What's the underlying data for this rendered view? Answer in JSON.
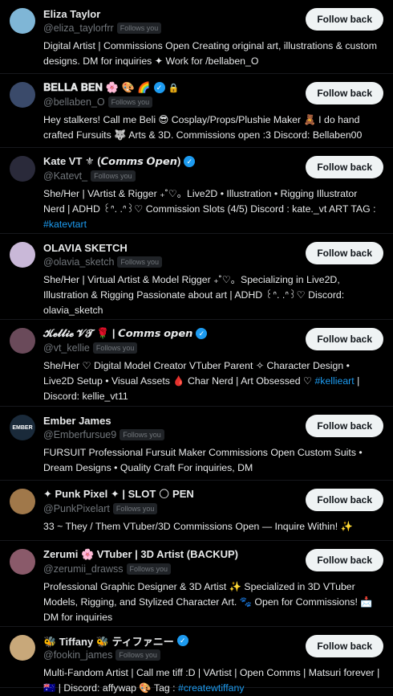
{
  "follow_back_label": "Follow back",
  "follows_you_label": "Follows you",
  "accent": "#1d9bf0",
  "users": [
    {
      "name": "Eliza Taylor",
      "handle": "@eliza_taylorfrr",
      "verified": false,
      "bio": "Digital Artist | Commissions Open Creating original art, illustrations & custom designs. DM for inquiries ✦ Work for /bellaben_O",
      "avatar_color": "#7fb6d6"
    },
    {
      "name": "𝐁𝐄𝐋𝐋𝐀 𝐁𝐄𝐍 🌸 🎨 🌈",
      "handle": "@bellaben_O",
      "verified": true,
      "locked": true,
      "bio": "Hey stalkers! Call me Beli 😎 Cosplay/Props/Plushie Maker 🧸 I do hand crafted Fursuits 🐺 Arts & 3D. Commissions open :3 Discord: Bellaben00",
      "avatar_color": "#3a4a6a"
    },
    {
      "name": "Kate VT ⚜ (𝘾𝙤𝙢𝙢𝙨 𝙊𝙥𝙚𝙣)",
      "handle": "@Katevt_",
      "verified": true,
      "bio": "She/Her | VArtist & Rigger ₊˚♡。Live2D • Illustration • Rigging Illustrator Nerd | ADHD ꒰ᐢ. .ᐢ꒱♡ Commission Slots (4/5) Discord : kate._vt ART TAG :",
      "tag": "#katevtart",
      "avatar_color": "#2a2a3a"
    },
    {
      "name": "OLAVIA SKETCH",
      "handle": "@olavia_sketch",
      "verified": false,
      "bio": "She/Her | Virtual Artist & Model Rigger ₊˚♡。Specializing in Live2D, Illustration & Rigging Passionate about art | ADHD ꒰ᐢ. .ᐢ꒱♡ Discord: olavia_sketch",
      "avatar_color": "#c9b8d8"
    },
    {
      "name": "𝓚𝓮𝓵𝓵𝓲𝓮 𝓥𝓣 🌹 | 𝘾𝙤𝙢𝙢𝙨 𝙤𝙥𝙚𝙣",
      "handle": "@vt_kellie",
      "verified": true,
      "bio": "She/Her ♡ Digital Model Creator VTuber Parent ✧ Character Design • Live2D Setup • Visual Assets 🩸 Char Nerd | Art Obsessed ♡",
      "tag": "#kellieart",
      "bio_after_tag": "| Discord: kellie_vt11",
      "avatar_color": "#6a4a5a"
    },
    {
      "name": "Ember James",
      "handle": "@Emberfursue9",
      "verified": false,
      "bio": "FURSUIT Professional Fursuit Maker Commissions Open Custom Suits • Dream Designs • Quality Craft For inquiries, DM",
      "avatar_color": "#1a2a3a",
      "avatar_text": "EMBER"
    },
    {
      "name": "✦ Punk Pixel ✦ | SLOT 🌕 PEN",
      "handle": "@PunkPixelart",
      "verified": false,
      "bio": "33 ~ They / Them VTuber/3D Commissions Open — Inquire Within! ✨",
      "avatar_color": "#a0784a"
    },
    {
      "name": "Zerumi 🌸 VTuber | 3D Artist (BACKUP)",
      "handle": "@zerumii_drawss",
      "verified": false,
      "bio": "Professional Graphic Designer & 3D Artist ✨ Specialized in 3D VTuber Models, Rigging, and Stylized Character Art. 🐾 Open for Commissions! 📩 DM for inquiries",
      "avatar_color": "#8a5a6a"
    },
    {
      "name": "🐝 Tiffany 🐝 ティファニー",
      "handle": "@fookin_james",
      "verified": true,
      "bio": "Multi-Fandom Artist | Call me tiff :D | VArtist | Open Comms | Matsuri forever | 🇦🇺 | Discord: affywap 🎨 Tag :",
      "tag": "#createwtiffany",
      "avatar_color": "#c8a87a"
    }
  ]
}
